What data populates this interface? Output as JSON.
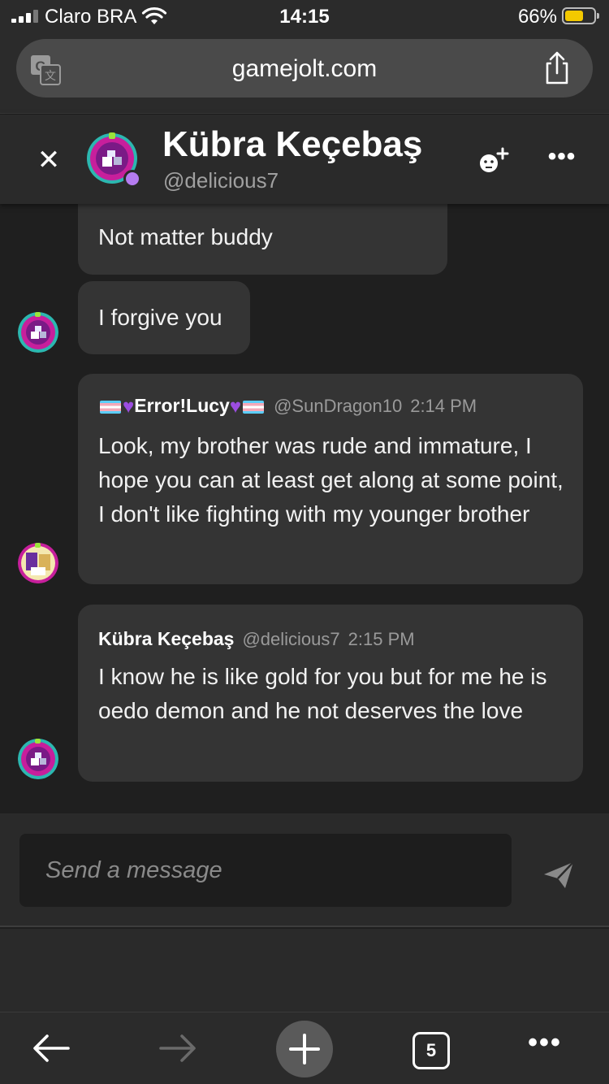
{
  "status_bar": {
    "carrier": "Claro BRA",
    "time": "14:15",
    "battery_percent": "66%",
    "battery_level": 0.66,
    "battery_color": "#f3c900"
  },
  "browser": {
    "url": "gamejolt.com",
    "translate_icon": "translate-icon",
    "share_icon": "share-icon"
  },
  "chat": {
    "name": "Kübra Keçebaş",
    "handle": "@delicious7",
    "online_color": "#b57cf0"
  },
  "messages": [
    {
      "text": "Not matter buddy"
    },
    {
      "text": "I forgive you"
    },
    {
      "author": "Error!Lucy",
      "handle": "@SunDragon10",
      "time": "2:14 PM",
      "text": "Look, my brother was rude and immature, I hope you can at least get along at some point, I don't like fighting with my younger brother"
    },
    {
      "author": "Kübra Keçebaş",
      "handle": "@delicious7",
      "time": "2:15 PM",
      "text": "I know he is like gold for you but for me he is oedo demon and he not deserves the love"
    }
  ],
  "composer": {
    "placeholder": "Send a message"
  },
  "toolbar": {
    "tab_count": "5"
  }
}
